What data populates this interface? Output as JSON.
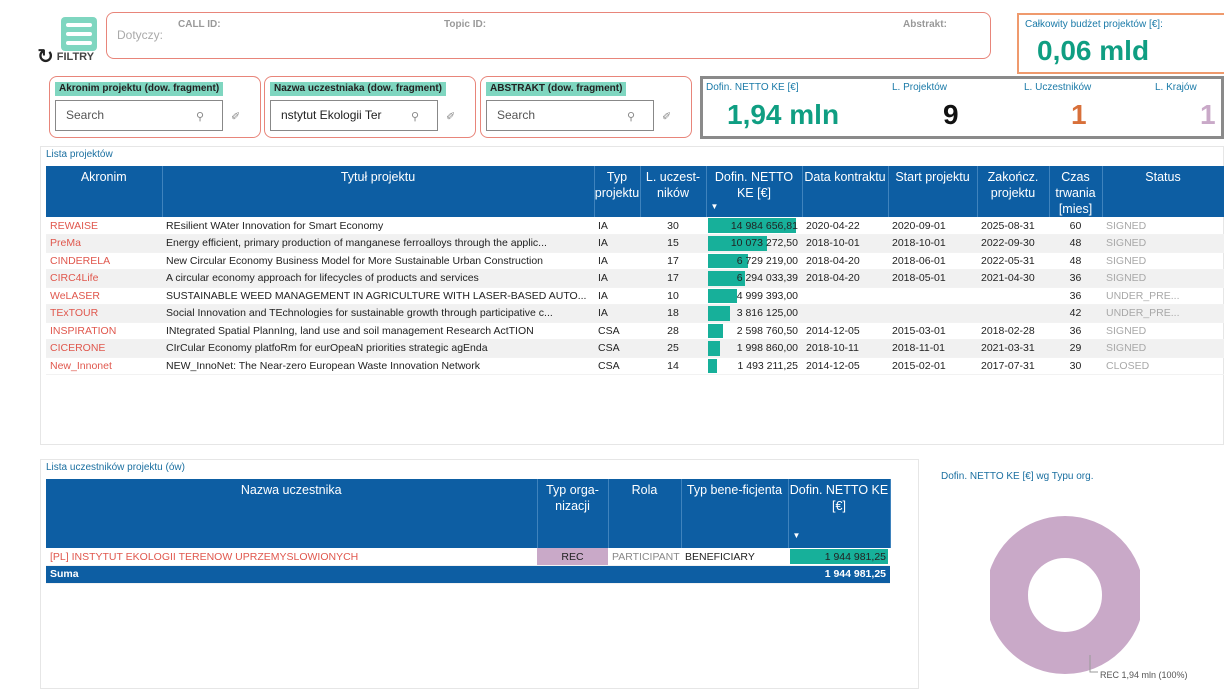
{
  "filters": {
    "filtry_label": "FILTRY",
    "dotyczy_label": "Dotyczy:",
    "call_id_label": "CALL ID:",
    "topic_id_label": "Topic ID:",
    "abstrakt_label": "Abstrakt:",
    "akronim_header": "Akronim projektu (dow. fragment)",
    "akronim_placeholder": "Search",
    "nazwa_header": "Nazwa uczestniaka (dow. fragment)",
    "nazwa_value": "nstytut Ekologii Ter",
    "abstrakt_header": "ABSTRAKT (dow. fragment)",
    "abstrakt_placeholder": "Search"
  },
  "budget": {
    "label": "Całkowity budżet projektów [€]:",
    "value": "0,06 mld"
  },
  "stats": {
    "dofin_label": "Dofin. NETTO KE [€]",
    "dofin_value": "1,94 mln",
    "projects_label": "L. Projektów",
    "projects_value": "9",
    "participants_label": "L. Uczestników",
    "participants_value": "1",
    "countries_label": "L. Krajów",
    "countries_value": "1"
  },
  "projects": {
    "title": "Lista projektów",
    "headers": [
      "Akronim",
      "Tytuł projektu",
      "Typ projektu",
      "L. uczest-ników",
      "Dofin. NETTO KE [€]",
      "Data kontraktu",
      "Start projektu",
      "Zakończ. projektu",
      "Czas trwania [mies]",
      "Status"
    ],
    "max_funding": 14984656.81,
    "rows": [
      {
        "acronym": "REWAISE",
        "title": "REsilient WAter Innovation for Smart Economy",
        "type": "IA",
        "participants": "30",
        "funding": "14 984 656,81",
        "funding_num": 14984656.81,
        "contract": "2020-04-22",
        "start": "2020-09-01",
        "end": "2025-08-31",
        "duration": "60",
        "status": "SIGNED"
      },
      {
        "acronym": "PreMa",
        "title": "Energy efficient, primary production of manganese ferroalloys through the applic...",
        "type": "IA",
        "participants": "15",
        "funding": "10 073 272,50",
        "funding_num": 10073272.5,
        "contract": "2018-10-01",
        "start": "2018-10-01",
        "end": "2022-09-30",
        "duration": "48",
        "status": "SIGNED"
      },
      {
        "acronym": "CINDERELA",
        "title": "New Circular Economy Business Model for More Sustainable Urban Construction",
        "type": "IA",
        "participants": "17",
        "funding": "6 729 219,00",
        "funding_num": 6729219.0,
        "contract": "2018-04-20",
        "start": "2018-06-01",
        "end": "2022-05-31",
        "duration": "48",
        "status": "SIGNED"
      },
      {
        "acronym": "CIRC4Life",
        "title": "A circular economy approach for lifecycles of products and services",
        "type": "IA",
        "participants": "17",
        "funding": "6 294 033,39",
        "funding_num": 6294033.39,
        "contract": "2018-04-20",
        "start": "2018-05-01",
        "end": "2021-04-30",
        "duration": "36",
        "status": "SIGNED"
      },
      {
        "acronym": "WeLASER",
        "title": "SUSTAINABLE WEED MANAGEMENT IN AGRICULTURE WITH LASER-BASED AUTO...",
        "type": "IA",
        "participants": "10",
        "funding": "4 999 393,00",
        "funding_num": 4999393.0,
        "contract": "",
        "start": "",
        "end": "",
        "duration": "36",
        "status": "UNDER_PRE..."
      },
      {
        "acronym": "TExTOUR",
        "title": "Social Innovation and TEchnologies for sustainable growth through participative c...",
        "type": "IA",
        "participants": "18",
        "funding": "3 816 125,00",
        "funding_num": 3816125.0,
        "contract": "",
        "start": "",
        "end": "",
        "duration": "42",
        "status": "UNDER_PRE..."
      },
      {
        "acronym": "INSPIRATION",
        "title": "INtegrated Spatial PlannIng, land use and soil management Research ActTION",
        "type": "CSA",
        "participants": "28",
        "funding": "2 598 760,50",
        "funding_num": 2598760.5,
        "contract": "2014-12-05",
        "start": "2015-03-01",
        "end": "2018-02-28",
        "duration": "36",
        "status": "SIGNED"
      },
      {
        "acronym": "CICERONE",
        "title": "CIrCular Economy platfoRm for eurOpeaN priorities strategic agEnda",
        "type": "CSA",
        "participants": "25",
        "funding": "1 998 860,00",
        "funding_num": 1998860.0,
        "contract": "2018-10-11",
        "start": "2018-11-01",
        "end": "2021-03-31",
        "duration": "29",
        "status": "SIGNED"
      },
      {
        "acronym": "New_Innonet",
        "title": "NEW_InnoNet: The Near-zero European Waste Innovation Network",
        "type": "CSA",
        "participants": "14",
        "funding": "1 493 211,25",
        "funding_num": 1493211.25,
        "contract": "2014-12-05",
        "start": "2015-02-01",
        "end": "2017-07-31",
        "duration": "30",
        "status": "CLOSED"
      }
    ]
  },
  "participants": {
    "title": "Lista uczestników projektu (ów)",
    "headers": [
      "Nazwa uczestnika",
      "Typ orga-nizacji",
      "Rola",
      "Typ bene-ficjenta",
      "Dofin. NETTO KE [€]"
    ],
    "rows": [
      {
        "name": "[PL] INSTYTUT EKOLOGII TERENOW UPRZEMYSLOWIONYCH",
        "org_type": "REC",
        "role": "PARTICIPANT",
        "beneficiary": "BENEFICIARY",
        "funding": "1 944 981,25"
      }
    ],
    "sum_label": "Suma",
    "sum_value": "1 944 981,25"
  },
  "donut": {
    "title": "Dofin. NETTO KE [€] wg Typu org.",
    "label": "REC 1,94 mln (100%)",
    "color": "#c9a9c8"
  },
  "colors": {
    "accent": "#0d5ea3",
    "teal": "#17b09a",
    "value_green": "#0f9e82",
    "orange": "#d8703a",
    "mauve": "#c9a9c8",
    "red_text": "#e0574d"
  }
}
